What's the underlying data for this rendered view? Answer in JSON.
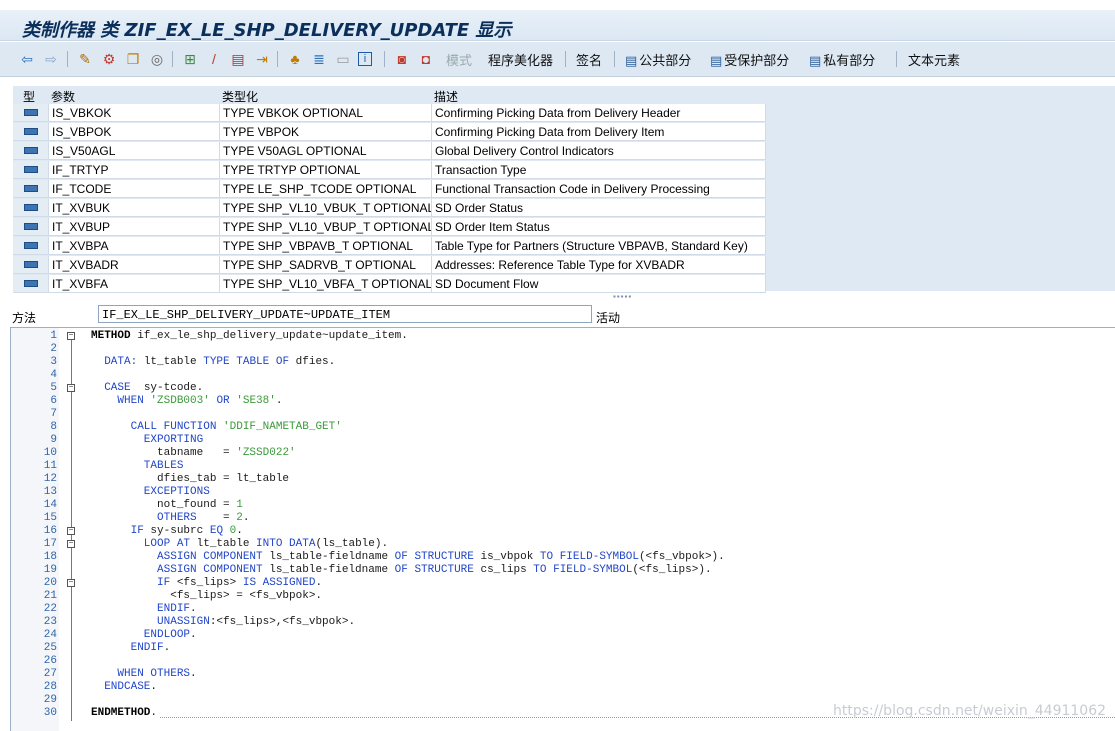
{
  "window": {
    "title": "类制作器 类 ZIF_EX_LE_SHP_DELIVERY_UPDATE 显示"
  },
  "toolbar": {
    "icons": [
      "back-icon",
      "forward-icon",
      "toggle-display-change-icon",
      "activate-icon",
      "copy-icon",
      "display-object-list-icon",
      "hierarchy-icon",
      "edit-icon",
      "where-used-icon",
      "navigate-icon",
      "structure-icon",
      "inheritance-icon",
      "layout-icon",
      "info-icon",
      "local-types-icon",
      "macros-icon"
    ],
    "mode_label": "模式",
    "pretty_printer_label": "程序美化器",
    "signature_label": "签名",
    "public_section_label": "公共部分",
    "protected_section_label": "受保护部分",
    "private_section_label": "私有部分",
    "text_elements_label": "文本元素"
  },
  "params": {
    "headers": {
      "type": "型",
      "param": "参数",
      "typing": "类型化",
      "desc": "描述"
    },
    "rows": [
      {
        "param": "IS_VBKOK",
        "typing": "TYPE VBKOK OPTIONAL",
        "desc": "Confirming Picking Data from Delivery Header"
      },
      {
        "param": "IS_VBPOK",
        "typing": "TYPE VBPOK",
        "desc": "Confirming Picking Data from Delivery Item"
      },
      {
        "param": "IS_V50AGL",
        "typing": "TYPE V50AGL OPTIONAL",
        "desc": "Global Delivery Control Indicators"
      },
      {
        "param": "IF_TRTYP",
        "typing": "TYPE TRTYP OPTIONAL",
        "desc": "Transaction Type"
      },
      {
        "param": "IF_TCODE",
        "typing": "TYPE LE_SHP_TCODE OPTIONAL",
        "desc": "Functional Transaction Code in Delivery Processing"
      },
      {
        "param": "IT_XVBUK",
        "typing": "TYPE SHP_VL10_VBUK_T OPTIONAL",
        "desc": "SD Order Status"
      },
      {
        "param": "IT_XVBUP",
        "typing": "TYPE SHP_VL10_VBUP_T OPTIONAL",
        "desc": "SD Order Item Status"
      },
      {
        "param": "IT_XVBPA",
        "typing": "TYPE SHP_VBPAVB_T OPTIONAL",
        "desc": "Table Type for Partners (Structure VBPAVB, Standard Key)"
      },
      {
        "param": "IT_XVBADR",
        "typing": "TYPE SHP_SADRVB_T OPTIONAL",
        "desc": "Addresses: Reference Table Type for XVBADR"
      },
      {
        "param": "IT_XVBFA",
        "typing": "TYPE SHP_VL10_VBFA_T OPTIONAL",
        "desc": "SD Document Flow"
      }
    ]
  },
  "method": {
    "label": "方法",
    "value": "IF_EX_LE_SHP_DELIVERY_UPDATE~UPDATE_ITEM",
    "status": "活动"
  },
  "code": {
    "lines": [
      {
        "n": "1",
        "fold": "⊟",
        "tokens": [
          [
            "bold",
            "METHOD"
          ],
          [
            "plain",
            " if_ex_le_shp_delivery_update~update_item."
          ]
        ]
      },
      {
        "n": "2",
        "fold": "",
        "tokens": []
      },
      {
        "n": "3",
        "fold": "",
        "tokens": [
          [
            "kw",
            "  DATA: "
          ],
          [
            "plain",
            "lt_table "
          ],
          [
            "kw",
            "TYPE TABLE OF "
          ],
          [
            "plain",
            "dfies."
          ]
        ]
      },
      {
        "n": "4",
        "fold": "",
        "tokens": []
      },
      {
        "n": "5",
        "fold": "⊟",
        "tokens": [
          [
            "kw",
            "  CASE  "
          ],
          [
            "plain",
            "sy-tcode."
          ]
        ]
      },
      {
        "n": "6",
        "fold": "",
        "tokens": [
          [
            "kw",
            "    WHEN "
          ],
          [
            "str",
            "'ZSDB003'"
          ],
          [
            "kw",
            " OR "
          ],
          [
            "str",
            "'SE38'"
          ],
          [
            "plain",
            "."
          ]
        ]
      },
      {
        "n": "7",
        "fold": "",
        "tokens": []
      },
      {
        "n": "8",
        "fold": "",
        "tokens": [
          [
            "kw",
            "      CALL FUNCTION "
          ],
          [
            "str",
            "'DDIF_NAMETAB_GET'"
          ]
        ]
      },
      {
        "n": "9",
        "fold": "",
        "tokens": [
          [
            "kw",
            "        EXPORTING"
          ]
        ]
      },
      {
        "n": "10",
        "fold": "",
        "tokens": [
          [
            "plain",
            "          tabname   = "
          ],
          [
            "str",
            "'ZSSD022'"
          ]
        ]
      },
      {
        "n": "11",
        "fold": "",
        "tokens": [
          [
            "kw",
            "        TABLES"
          ]
        ]
      },
      {
        "n": "12",
        "fold": "",
        "tokens": [
          [
            "plain",
            "          dfies_tab = lt_table"
          ]
        ]
      },
      {
        "n": "13",
        "fold": "",
        "tokens": [
          [
            "kw",
            "        EXCEPTIONS"
          ]
        ]
      },
      {
        "n": "14",
        "fold": "",
        "tokens": [
          [
            "plain",
            "          not_found = "
          ],
          [
            "num",
            "1"
          ]
        ]
      },
      {
        "n": "15",
        "fold": "",
        "tokens": [
          [
            "kw",
            "          OTHERS    "
          ],
          [
            "plain",
            "= "
          ],
          [
            "num",
            "2"
          ],
          [
            "plain",
            "."
          ]
        ]
      },
      {
        "n": "16",
        "fold": "⊟",
        "tokens": [
          [
            "kw",
            "      IF "
          ],
          [
            "plain",
            "sy-subrc "
          ],
          [
            "kw",
            "EQ "
          ],
          [
            "num",
            "0"
          ],
          [
            "plain",
            "."
          ]
        ]
      },
      {
        "n": "17",
        "fold": "⊟",
        "tokens": [
          [
            "kw",
            "        LOOP AT "
          ],
          [
            "plain",
            "lt_table "
          ],
          [
            "kw",
            "INTO DATA"
          ],
          [
            "plain",
            "(ls_table)."
          ]
        ]
      },
      {
        "n": "18",
        "fold": "",
        "tokens": [
          [
            "kw",
            "          ASSIGN COMPONENT "
          ],
          [
            "plain",
            "ls_table-fieldname "
          ],
          [
            "kw",
            "OF STRUCTURE "
          ],
          [
            "plain",
            "is_vbpok "
          ],
          [
            "kw",
            "TO FIELD-SYMBOL"
          ],
          [
            "plain",
            "(<fs_vbpok>)."
          ]
        ]
      },
      {
        "n": "19",
        "fold": "",
        "tokens": [
          [
            "kw",
            "          ASSIGN COMPONENT "
          ],
          [
            "plain",
            "ls_table-fieldname "
          ],
          [
            "kw",
            "OF STRUCTURE "
          ],
          [
            "plain",
            "cs_lips "
          ],
          [
            "kw",
            "TO FIELD-SYMBOL"
          ],
          [
            "plain",
            "(<fs_lips>)."
          ]
        ]
      },
      {
        "n": "20",
        "fold": "⊟",
        "tokens": [
          [
            "kw",
            "          IF "
          ],
          [
            "plain",
            "<fs_lips> "
          ],
          [
            "kw",
            "IS ASSIGNED"
          ],
          [
            "plain",
            "."
          ]
        ]
      },
      {
        "n": "21",
        "fold": "",
        "tokens": [
          [
            "plain",
            "            <fs_lips> = <fs_vbpok>."
          ]
        ]
      },
      {
        "n": "22",
        "fold": "",
        "tokens": [
          [
            "kw",
            "          ENDIF"
          ],
          [
            "plain",
            "."
          ]
        ]
      },
      {
        "n": "23",
        "fold": "",
        "tokens": [
          [
            "kw",
            "          UNASSIGN"
          ],
          [
            "plain",
            ":<fs_lips>,<fs_vbpok>."
          ]
        ]
      },
      {
        "n": "24",
        "fold": "",
        "tokens": [
          [
            "kw",
            "        ENDLOOP"
          ],
          [
            "plain",
            "."
          ]
        ]
      },
      {
        "n": "25",
        "fold": "",
        "tokens": [
          [
            "kw",
            "      ENDIF"
          ],
          [
            "plain",
            "."
          ]
        ]
      },
      {
        "n": "26",
        "fold": "",
        "tokens": []
      },
      {
        "n": "27",
        "fold": "",
        "tokens": [
          [
            "kw",
            "    WHEN OTHERS"
          ],
          [
            "plain",
            "."
          ]
        ]
      },
      {
        "n": "28",
        "fold": "",
        "tokens": [
          [
            "kw",
            "  ENDCASE"
          ],
          [
            "plain",
            "."
          ]
        ]
      },
      {
        "n": "29",
        "fold": "",
        "tokens": []
      },
      {
        "n": "30",
        "fold": "",
        "tokens": [
          [
            "bold",
            "ENDMETHOD"
          ],
          [
            "plain",
            "."
          ]
        ]
      }
    ]
  },
  "watermark": "https://blog.csdn.net/weixin_44911062"
}
